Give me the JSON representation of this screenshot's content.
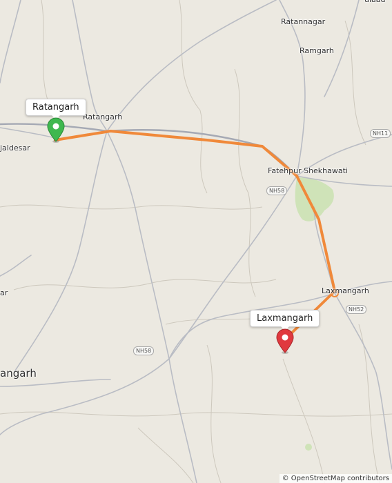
{
  "map": {
    "places": {
      "ratangarh": "Ratangarh",
      "rajaldesar": "jaldesar",
      "ratannagar": "Ratannagar",
      "ramgarh": "Ramgarh",
      "fatehpur": "Fatehpur Shekhawati",
      "laxmangarh_town": "Laxmangarh",
      "sujangarh": "angarh",
      "left_edge": "ar",
      "top_right": "ulaad"
    },
    "road_shields": {
      "nh11": "NH11",
      "nh58_north": "NH58",
      "nh58_south": "NH58",
      "nh52": "NH52"
    },
    "markers": {
      "start": {
        "label": "Ratangarh",
        "color": "#3fb84f"
      },
      "end": {
        "label": "Laxmangarh",
        "color": "#e0393e"
      }
    },
    "route_color": "#f0893a",
    "attribution": "© OpenStreetMap contributors"
  }
}
